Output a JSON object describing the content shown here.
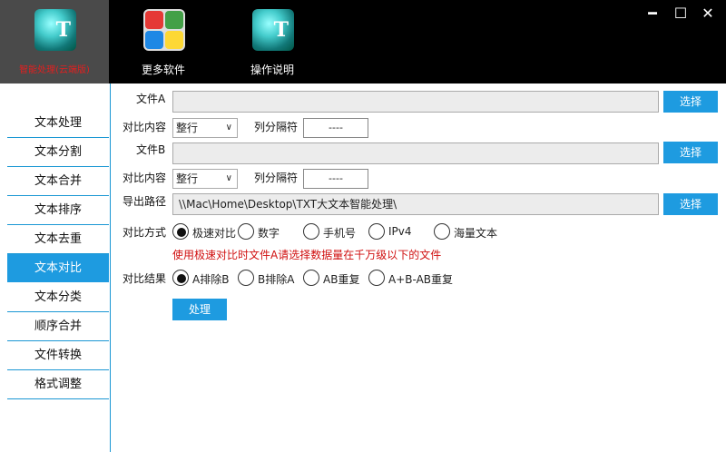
{
  "toolbar": {
    "items": [
      {
        "label": "智能处理(云端版)",
        "icon": "teal-portrait-T-icon"
      },
      {
        "label": "更多软件",
        "icon": "colorful-grid-icon"
      },
      {
        "label": "操作说明",
        "icon": "teal-portrait-T-icon"
      }
    ],
    "icon_letter": "T"
  },
  "window": {
    "minimize": "━",
    "maximize": "☐",
    "close": "✕"
  },
  "sidebar": {
    "items": [
      "文本处理",
      "文本分割",
      "文本合并",
      "文本排序",
      "文本去重",
      "文本对比",
      "文本分类",
      "顺序合并",
      "文件转换",
      "格式调整"
    ],
    "active": "文本对比"
  },
  "form": {
    "file_a_label": "文件A",
    "file_b_label": "文件B",
    "compare_content_label": "对比内容",
    "compare_select_a": "整行",
    "compare_select_b": "整行",
    "separator_label": "列分隔符",
    "separator_a": "----",
    "separator_b": "----",
    "file_a_value": "",
    "file_b_value": "",
    "export_label": "导出路径",
    "export_path": "\\\\Mac\\Home\\Desktop\\TXT大文本智能处理\\",
    "choose_label": "选择",
    "mode_label": "对比方式",
    "modes": [
      "极速对比",
      "数字",
      "手机号",
      "IPv4",
      "海量文本"
    ],
    "mode_selected": 0,
    "warning": "使用极速对比时文件A请选择数据量在千万级以下的文件",
    "result_label": "对比结果",
    "results": [
      "A排除B",
      "B排除A",
      "AB重复",
      "A+B-AB重复"
    ],
    "result_selected": 0,
    "process_label": "处理"
  },
  "colors": {
    "accent": "#1e9be0",
    "warning": "#d01010",
    "toolbar": "#000000"
  }
}
